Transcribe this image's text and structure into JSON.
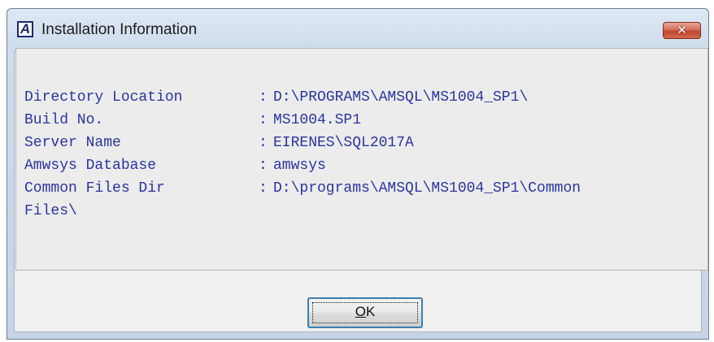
{
  "window": {
    "title": "Installation Information",
    "icon": "app-letter-a-icon",
    "icon_letter": "A",
    "close_glyph": "✕"
  },
  "info": {
    "separator": ":",
    "rows": [
      {
        "label": "Directory Location",
        "value": "D:\\PROGRAMS\\AMSQL\\MS1004_SP1\\"
      },
      {
        "label": "Build No.",
        "value": "MS1004.SP1"
      },
      {
        "label": "Server Name",
        "value": "EIRENES\\SQL2017A"
      },
      {
        "label": "Amwsys Database",
        "value": "amwsys"
      },
      {
        "label": "Common Files Dir",
        "value": "D:\\programs\\AMSQL\\MS1004_SP1\\Common"
      }
    ],
    "wrapped_continuation": "Files\\"
  },
  "buttons": {
    "ok_mnemonic": "O",
    "ok_rest": "K"
  },
  "colors": {
    "info_text": "#2a34a3",
    "close_button": "#c1452d",
    "ok_focus_border": "#3c7fb1"
  }
}
